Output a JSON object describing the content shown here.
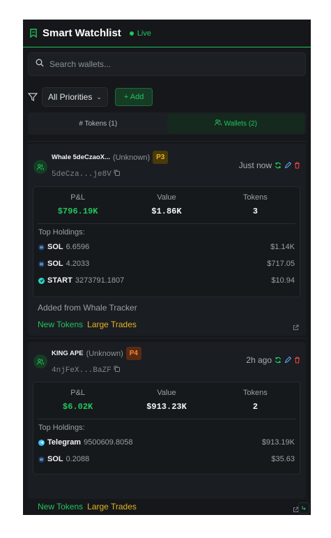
{
  "header": {
    "title": "Smart Watchlist",
    "status": "Live"
  },
  "search": {
    "placeholder": "Search wallets..."
  },
  "filters": {
    "priority_label": "All Priorities",
    "add_label": "+ Add"
  },
  "tabs": [
    {
      "label": "# Tokens (1)",
      "active": false
    },
    {
      "label": "Wallets (2)",
      "active": true
    }
  ],
  "wallets": [
    {
      "name": "Whale 5deCzaoX...",
      "tag": "(Unknown)",
      "priority": "P3",
      "address": "5deCza...je8V",
      "time": "Just now",
      "pnl": "$796.19K",
      "value": "$1.86K",
      "tokens": "3",
      "holdings_title": "Top Holdings:",
      "holdings": [
        {
          "symbol": "SOL",
          "amount": "6.6596",
          "usd": "$1.14K",
          "icon": "sol-icon"
        },
        {
          "symbol": "SOL",
          "amount": "4.2033",
          "usd": "$717.05",
          "icon": "sol-icon"
        },
        {
          "symbol": "START",
          "amount": "3273791.1807",
          "usd": "$10.94",
          "icon": "start-icon"
        }
      ],
      "note": "Added from Whale Tracker",
      "alerts": [
        "New Tokens",
        "Large Trades"
      ]
    },
    {
      "name": "KING APE",
      "tag": "(Unknown)",
      "priority": "P4",
      "address": "4njFeX...BaZF",
      "time": "2h ago",
      "pnl": "$6.02K",
      "value": "$913.23K",
      "tokens": "2",
      "holdings_title": "Top Holdings:",
      "holdings": [
        {
          "symbol": "Telegram",
          "amount": "9500609.8058",
          "usd": "$913.19K",
          "icon": "telegram-icon"
        },
        {
          "symbol": "SOL",
          "amount": "0.2088",
          "usd": "$35.63",
          "icon": "sol-icon"
        }
      ],
      "alerts": [
        "New Tokens",
        "Large Trades"
      ]
    }
  ],
  "stat_labels": {
    "pnl": "P&L",
    "value": "Value",
    "tokens": "Tokens"
  },
  "colors": {
    "accent": "#22c55e",
    "warning": "#e6b422",
    "p4": "#f08a3a",
    "danger": "#ef4444",
    "background": "#15171a"
  }
}
